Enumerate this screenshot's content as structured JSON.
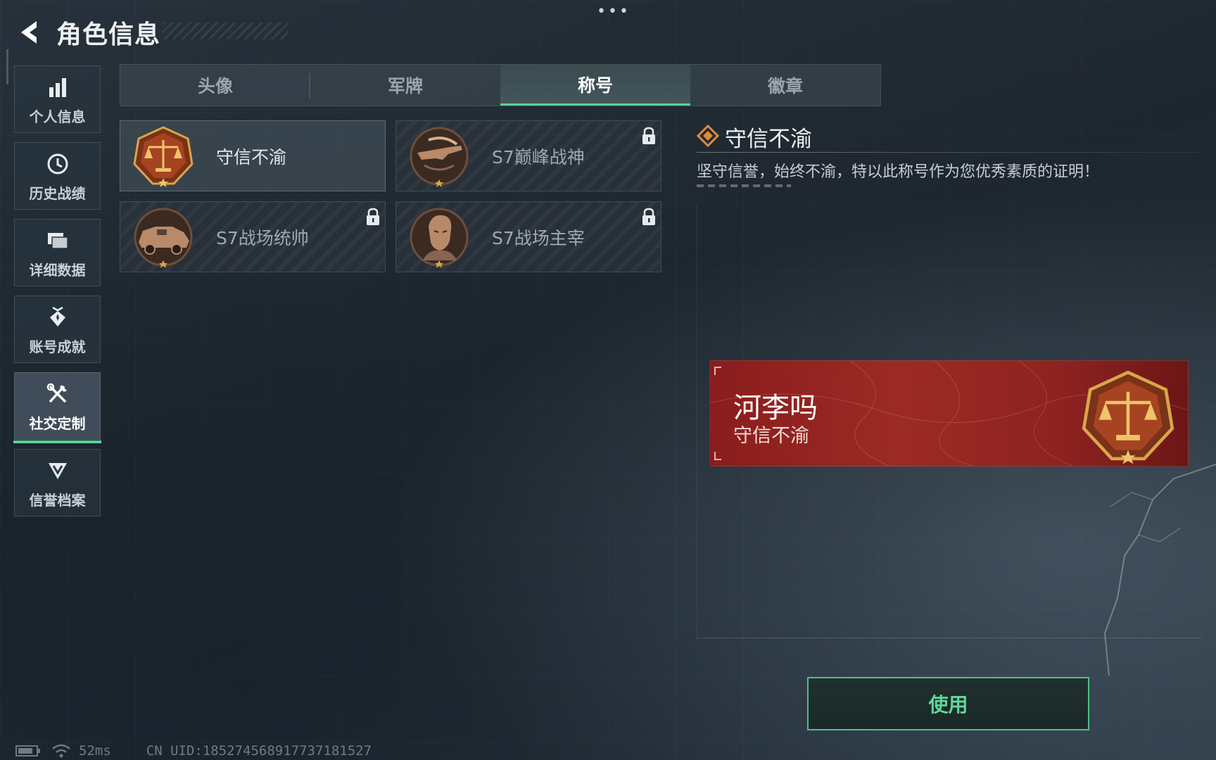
{
  "header": {
    "title": "角色信息",
    "more_dots": "•••"
  },
  "sidebar": {
    "items": [
      {
        "label": "个人信息",
        "icon": "bar-chart-icon"
      },
      {
        "label": "历史战绩",
        "icon": "history-clock-icon"
      },
      {
        "label": "详细数据",
        "icon": "folders-icon"
      },
      {
        "label": "账号成就",
        "icon": "achievement-badge-icon"
      },
      {
        "label": "社交定制",
        "icon": "tools-icon",
        "active": true
      },
      {
        "label": "信誉档案",
        "icon": "shield-chevron-icon"
      }
    ]
  },
  "tabs": [
    {
      "label": "头像"
    },
    {
      "label": "军牌"
    },
    {
      "label": "称号",
      "active": true
    },
    {
      "label": "徽章"
    }
  ],
  "titles": [
    {
      "name": "守信不渝",
      "medal": "scales-medal",
      "locked": false,
      "selected": true
    },
    {
      "name": "S7巅峰战神",
      "medal": "rifle-medal",
      "locked": true
    },
    {
      "name": "S7战场统帅",
      "medal": "vehicle-medal",
      "locked": true
    },
    {
      "name": "S7战场主宰",
      "medal": "soldier-medal",
      "locked": true
    }
  ],
  "detail": {
    "title": "守信不渝",
    "description": "坚守信誉，始终不渝，特以此称号作为您优秀素质的证明！"
  },
  "preview": {
    "player_name": "河李吗",
    "title": "守信不渝"
  },
  "use_button": "使用",
  "status": {
    "ping": "52ms",
    "uid": "CN UID:185274568917737181527"
  },
  "colors": {
    "accent": "#5dd09a",
    "banner_red": "#9c2a24",
    "medal_gold": "#d9a54b",
    "detail_icon": "#e08a3c"
  }
}
